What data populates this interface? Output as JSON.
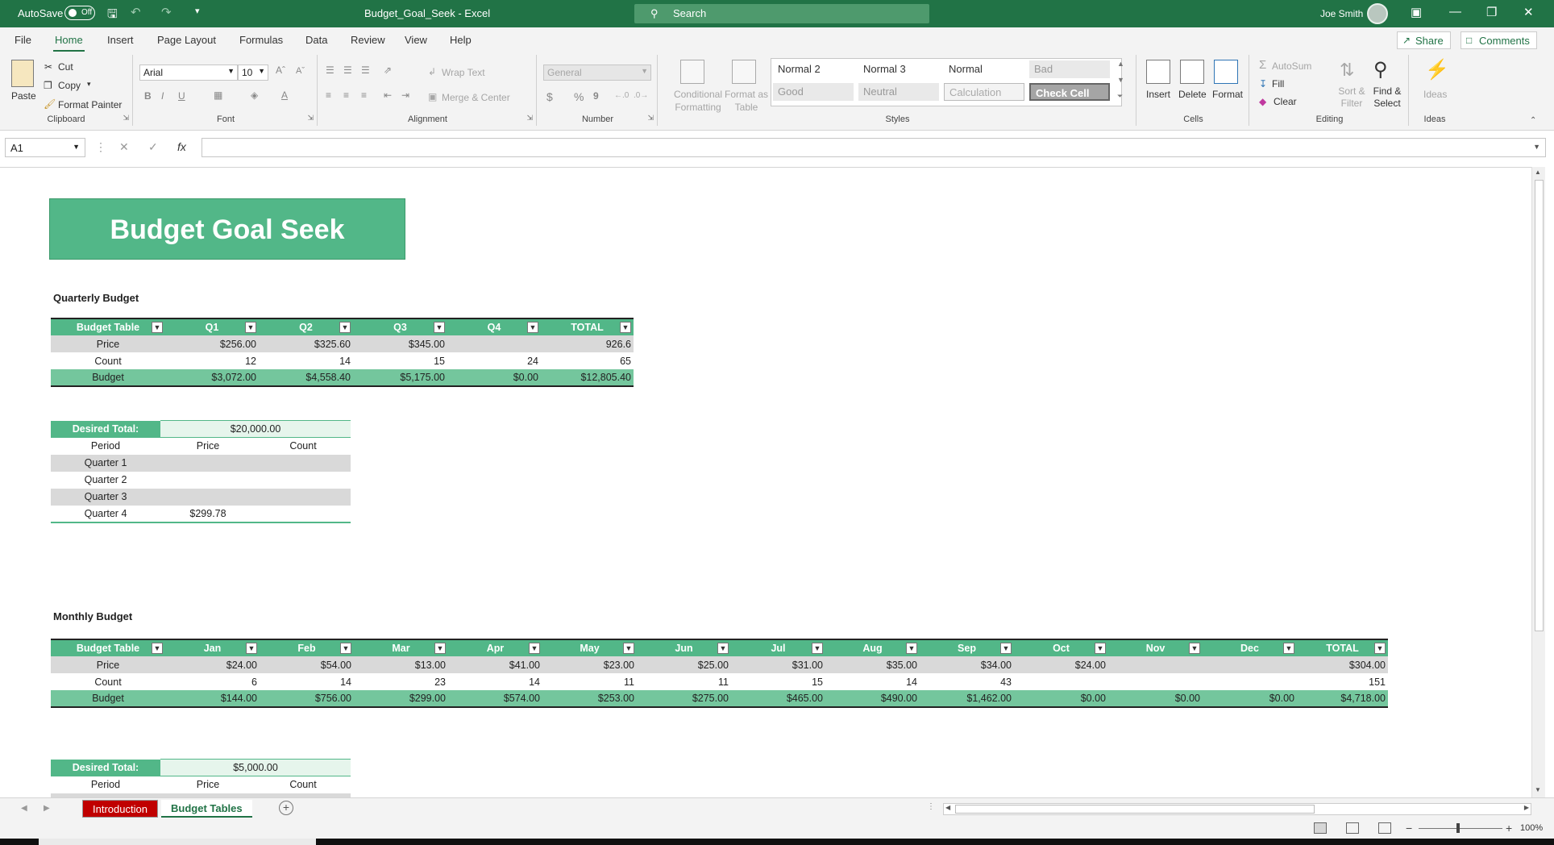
{
  "titlebar": {
    "autosave_label": "AutoSave",
    "autosave_state": "Off",
    "doc_title": "Budget_Goal_Seek  -  Excel",
    "search_placeholder": "Search",
    "user_name": "Joe Smith",
    "accent": "#217346"
  },
  "menu": {
    "items": [
      "File",
      "Home",
      "Insert",
      "Page Layout",
      "Formulas",
      "Data",
      "Review",
      "View",
      "Help"
    ],
    "active": "Home",
    "share": "Share",
    "comments": "Comments"
  },
  "ribbon": {
    "clipboard": {
      "label": "Clipboard",
      "paste": "Paste",
      "cut": "Cut",
      "copy": "Copy",
      "format_painter": "Format Painter"
    },
    "font": {
      "label": "Font",
      "name": "Arial",
      "size": "10",
      "bold": "B",
      "italic": "I",
      "underline": "U"
    },
    "alignment": {
      "label": "Alignment",
      "wrap": "Wrap Text",
      "merge": "Merge & Center"
    },
    "number": {
      "label": "Number",
      "format": "General",
      "dollar": "$",
      "percent": "%",
      "comma": "9"
    },
    "styles": {
      "label": "Styles",
      "conditional": "Conditional Formatting",
      "format_table": "Format as Table",
      "cells": [
        "Normal 2",
        "Normal 3",
        "Normal",
        "Bad",
        "Good",
        "Neutral",
        "Calculation",
        "Check Cell"
      ]
    },
    "cells": {
      "label": "Cells",
      "insert": "Insert",
      "delete": "Delete",
      "format": "Format"
    },
    "editing": {
      "label": "Editing",
      "autosum": "AutoSum",
      "fill": "Fill",
      "clear": "Clear",
      "sort": "Sort & Filter",
      "find": "Find & Select"
    },
    "ideas": {
      "label": "Ideas",
      "ideas": "Ideas"
    }
  },
  "formula_bar": {
    "name_box": "A1",
    "fx": "fx",
    "cancel": "✕",
    "enter": "✓",
    "value": ""
  },
  "sheet": {
    "banner_title": "Budget Goal Seek",
    "quarterly": {
      "title": "Quarterly Budget",
      "headers": [
        "Budget Table",
        "Q1",
        "Q2",
        "Q3",
        "Q4",
        "TOTAL"
      ],
      "rows": [
        [
          "Price",
          "$256.00",
          "$325.60",
          "$345.00",
          "",
          "926.6"
        ],
        [
          "Count",
          "12",
          "14",
          "15",
          "24",
          "65"
        ],
        [
          "Budget",
          "$3,072.00",
          "$4,558.40",
          "$5,175.00",
          "$0.00",
          "$12,805.40"
        ]
      ]
    },
    "quarterly_goal": {
      "desired_label": "Desired Total:",
      "desired_value": "$20,000.00",
      "col_headers": [
        "Period",
        "Price",
        "Count"
      ],
      "rows": [
        [
          "Quarter 1",
          "",
          ""
        ],
        [
          "Quarter 2",
          "",
          ""
        ],
        [
          "Quarter 3",
          "",
          ""
        ],
        [
          "Quarter 4",
          "$299.78",
          ""
        ]
      ]
    },
    "monthly": {
      "title": "Monthly Budget",
      "headers": [
        "Budget Table",
        "Jan",
        "Feb",
        "Mar",
        "Apr",
        "May",
        "Jun",
        "Jul",
        "Aug",
        "Sep",
        "Oct",
        "Nov",
        "Dec",
        "TOTAL"
      ],
      "rows": [
        [
          "Price",
          "$24.00",
          "$54.00",
          "$13.00",
          "$41.00",
          "$23.00",
          "$25.00",
          "$31.00",
          "$35.00",
          "$34.00",
          "$24.00",
          "",
          "",
          "$304.00"
        ],
        [
          "Count",
          "6",
          "14",
          "23",
          "14",
          "11",
          "11",
          "15",
          "14",
          "43",
          "",
          "",
          "",
          "151"
        ],
        [
          "Budget",
          "$144.00",
          "$756.00",
          "$299.00",
          "$574.00",
          "$253.00",
          "$275.00",
          "$465.00",
          "$490.00",
          "$1,462.00",
          "$0.00",
          "$0.00",
          "$0.00",
          "$4,718.00"
        ]
      ]
    },
    "monthly_goal": {
      "desired_label": "Desired Total:",
      "desired_value": "$5,000.00",
      "col_headers": [
        "Period",
        "Price",
        "Count"
      ]
    }
  },
  "tabs": {
    "items": [
      "Introduction",
      "Budget Tables"
    ],
    "active": "Budget Tables"
  },
  "status": {
    "zoom": "100%"
  }
}
